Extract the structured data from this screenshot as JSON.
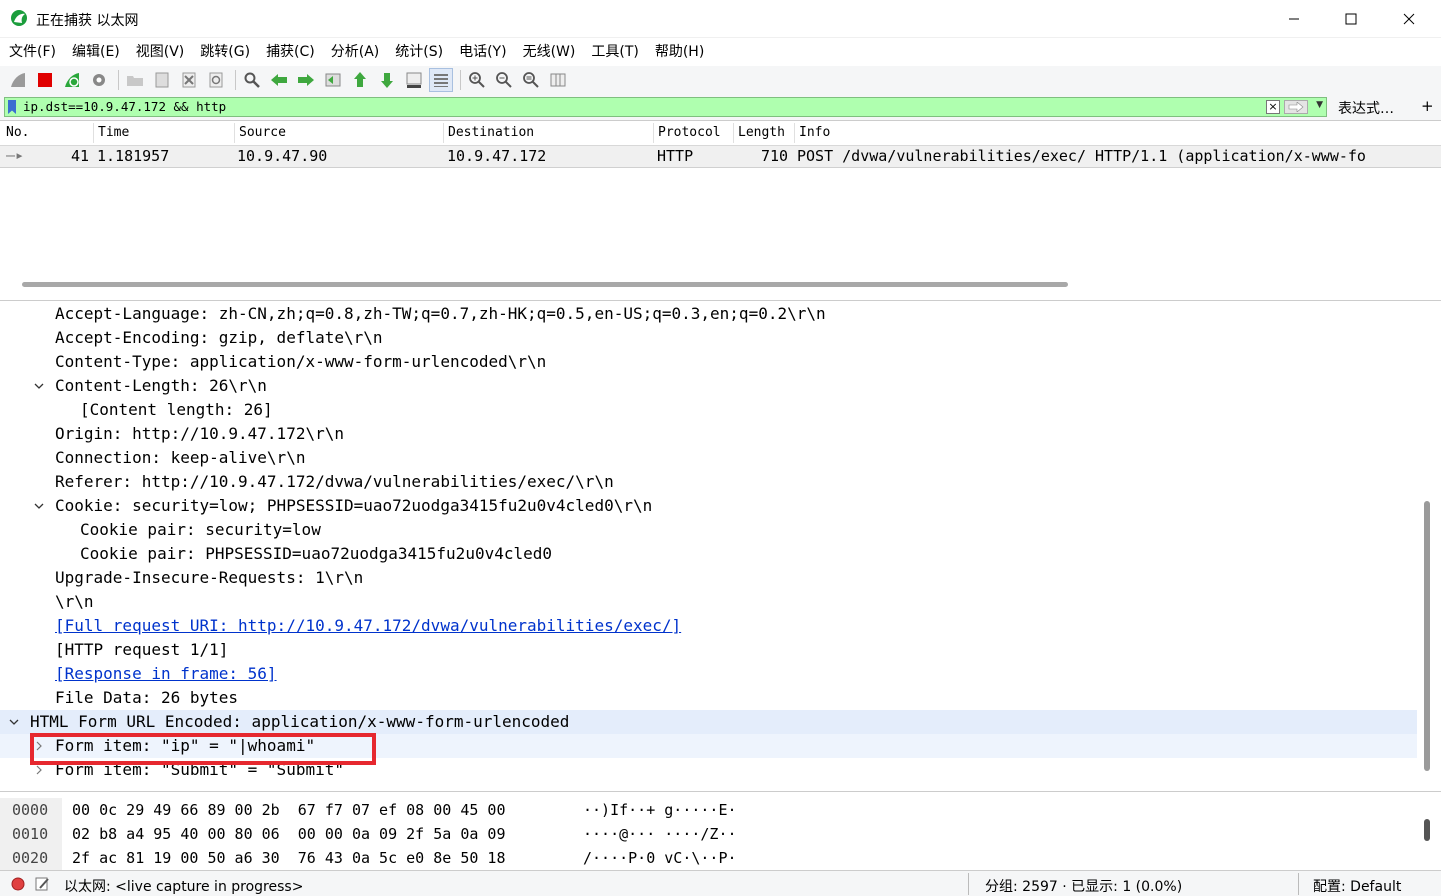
{
  "window": {
    "title": "正在捕获 以太网"
  },
  "menu": [
    "文件(F)",
    "编辑(E)",
    "视图(V)",
    "跳转(G)",
    "捕获(C)",
    "分析(A)",
    "统计(S)",
    "电话(Y)",
    "无线(W)",
    "工具(T)",
    "帮助(H)"
  ],
  "filter": {
    "value": "ip.dst==10.9.47.172 && http",
    "expression_label": "表达式…",
    "plus_label": "+",
    "bg_color": "#afffaf"
  },
  "packet_list": {
    "columns": [
      "No.",
      "Time",
      "Source",
      "Destination",
      "Protocol",
      "Length",
      "Info"
    ],
    "rows": [
      {
        "no": "41",
        "time": "1.181957",
        "source": "10.9.47.90",
        "destination": "10.9.47.172",
        "protocol": "HTTP",
        "length": "710",
        "info": "POST /dvwa/vulnerabilities/exec/ HTTP/1.1  (application/x-www-fo"
      }
    ]
  },
  "details": [
    {
      "text": "Accept-Language: zh-CN,zh;q=0.8,zh-TW;q=0.7,zh-HK;q=0.5,en-US;q=0.3,en;q=0.2\\r\\n",
      "indent": 1,
      "arrow": ""
    },
    {
      "text": "Accept-Encoding: gzip, deflate\\r\\n",
      "indent": 1,
      "arrow": ""
    },
    {
      "text": "Content-Type: application/x-www-form-urlencoded\\r\\n",
      "indent": 1,
      "arrow": ""
    },
    {
      "text": "Content-Length: 26\\r\\n",
      "indent": 1,
      "arrow": "down"
    },
    {
      "text": "[Content length: 26]",
      "indent": 2,
      "arrow": ""
    },
    {
      "text": "Origin: http://10.9.47.172\\r\\n",
      "indent": 1,
      "arrow": ""
    },
    {
      "text": "Connection: keep-alive\\r\\n",
      "indent": 1,
      "arrow": ""
    },
    {
      "text": "Referer: http://10.9.47.172/dvwa/vulnerabilities/exec/\\r\\n",
      "indent": 1,
      "arrow": ""
    },
    {
      "text": "Cookie: security=low; PHPSESSID=uao72uodga3415fu2u0v4cled0\\r\\n",
      "indent": 1,
      "arrow": "down"
    },
    {
      "text": "Cookie pair: security=low",
      "indent": 2,
      "arrow": ""
    },
    {
      "text": "Cookie pair: PHPSESSID=uao72uodga3415fu2u0v4cled0",
      "indent": 2,
      "arrow": ""
    },
    {
      "text": "Upgrade-Insecure-Requests: 1\\r\\n",
      "indent": 1,
      "arrow": ""
    },
    {
      "text": "\\r\\n",
      "indent": 1,
      "arrow": ""
    },
    {
      "text": "[Full request URI: http://10.9.47.172/dvwa/vulnerabilities/exec/]",
      "indent": 1,
      "arrow": "",
      "link": true
    },
    {
      "text": "[HTTP request 1/1]",
      "indent": 1,
      "arrow": ""
    },
    {
      "text": "[Response in frame: 56]",
      "indent": 1,
      "arrow": "",
      "link": true
    },
    {
      "text": "File Data: 26 bytes",
      "indent": 1,
      "arrow": ""
    },
    {
      "text": "HTML Form URL Encoded: application/x-www-form-urlencoded",
      "indent": 0,
      "arrow": "down"
    },
    {
      "text": "Form item: \"ip\" = \"|whoami\"",
      "indent": 1,
      "arrow": "right",
      "selected": true
    },
    {
      "text": "Form item: \"Submit\" = \"Submit\"",
      "indent": 1,
      "arrow": "right"
    }
  ],
  "bytes": [
    {
      "offset": "0000",
      "hex": "00 0c 29 49 66 89 00 2b  67 f7 07 ef 08 00 45 00",
      "ascii": "··)If··+ g·····E·"
    },
    {
      "offset": "0010",
      "hex": "02 b8 a4 95 40 00 80 06  00 00 0a 09 2f 5a 0a 09",
      "ascii": "····@··· ····/Z··"
    },
    {
      "offset": "0020",
      "hex": "2f ac 81 19 00 50 a6 30  76 43 0a 5c e0 8e 50 18",
      "ascii": "/····P·0 vC·\\··P·"
    }
  ],
  "status": {
    "interface": "以太网: <live capture in progress>",
    "packets": "分组: 2597 · 已显示: 1 (0.0%)",
    "profile": "配置: Default"
  }
}
